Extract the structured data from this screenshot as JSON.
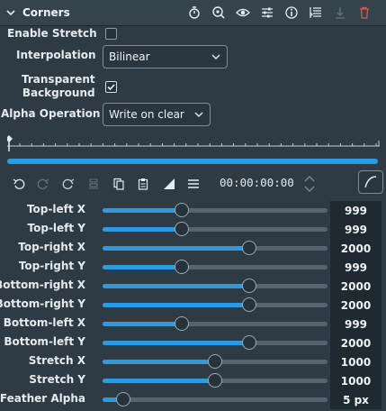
{
  "header": {
    "title": "Corners"
  },
  "settings": {
    "enable_stretch": {
      "label": "Enable Stretch",
      "checked": false
    },
    "interpolation": {
      "label": "Interpolation",
      "value": "Bilinear"
    },
    "transparent_bg": {
      "label_line1": "Transparent",
      "label_line2": "Background",
      "checked": true
    },
    "alpha_operation": {
      "label": "Alpha Operation",
      "value": "Write on clear"
    }
  },
  "timeline": {
    "timecode": "00:00:00:00"
  },
  "params": [
    {
      "label": "Top-left X",
      "value": "999",
      "fraction": 0.35
    },
    {
      "label": "Top-left Y",
      "value": "999",
      "fraction": 0.35
    },
    {
      "label": "Top-right X",
      "value": "2000",
      "fraction": 0.65
    },
    {
      "label": "Top-right Y",
      "value": "999",
      "fraction": 0.35
    },
    {
      "label": "Bottom-right X",
      "value": "2000",
      "fraction": 0.65
    },
    {
      "label": "Bottom-right Y",
      "value": "2000",
      "fraction": 0.65
    },
    {
      "label": "Bottom-left X",
      "value": "999",
      "fraction": 0.35
    },
    {
      "label": "Bottom-left Y",
      "value": "2000",
      "fraction": 0.65
    },
    {
      "label": "Stretch X",
      "value": "1000",
      "fraction": 0.5
    },
    {
      "label": "Stretch Y",
      "value": "1000",
      "fraction": 0.5
    },
    {
      "label": "Feather Alpha",
      "value": "5 px",
      "fraction": 0.09
    }
  ],
  "colors": {
    "accent": "#2e9be0",
    "delete": "#e0574f"
  },
  "icons": [
    "chevron-down-icon",
    "timer-icon",
    "zoom-icon",
    "eye-icon",
    "sliders-icon",
    "info-icon",
    "list-icon",
    "move-down-icon",
    "trash-icon",
    "undo-icon",
    "redo-icon",
    "redo-alt-icon",
    "stack-icon",
    "copy-icon",
    "paste-icon",
    "ramp-icon",
    "menu-icon",
    "curve-icon"
  ]
}
